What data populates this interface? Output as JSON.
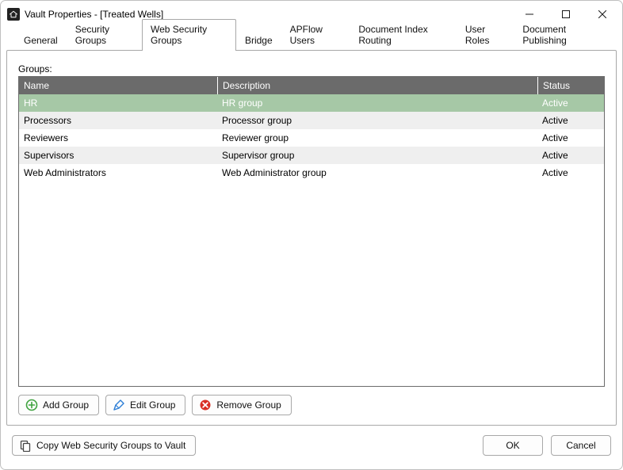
{
  "window": {
    "title": "Vault Properties - [Treated Wells]"
  },
  "tabs": [
    {
      "label": "General"
    },
    {
      "label": "Security Groups"
    },
    {
      "label": "Web Security Groups"
    },
    {
      "label": "Bridge"
    },
    {
      "label": "APFlow Users"
    },
    {
      "label": "Document Index Routing"
    },
    {
      "label": "User Roles"
    },
    {
      "label": "Document Publishing"
    }
  ],
  "selected_tab_index": 2,
  "groups_label": "Groups:",
  "columns": {
    "name": "Name",
    "description": "Description",
    "status": "Status"
  },
  "rows": [
    {
      "name": "HR",
      "description": "HR group",
      "status": "Active"
    },
    {
      "name": "Processors",
      "description": "Processor group",
      "status": "Active"
    },
    {
      "name": "Reviewers",
      "description": "Reviewer group",
      "status": "Active"
    },
    {
      "name": "Supervisors",
      "description": "Supervisor group",
      "status": "Active"
    },
    {
      "name": "Web Administrators",
      "description": "Web Administrator group",
      "status": "Active"
    }
  ],
  "selected_row_index": 0,
  "buttons": {
    "add_group": "Add Group",
    "edit_group": "Edit Group",
    "remove_group": "Remove Group",
    "copy_to_vault": "Copy Web Security Groups to Vault",
    "ok": "OK",
    "cancel": "Cancel"
  }
}
